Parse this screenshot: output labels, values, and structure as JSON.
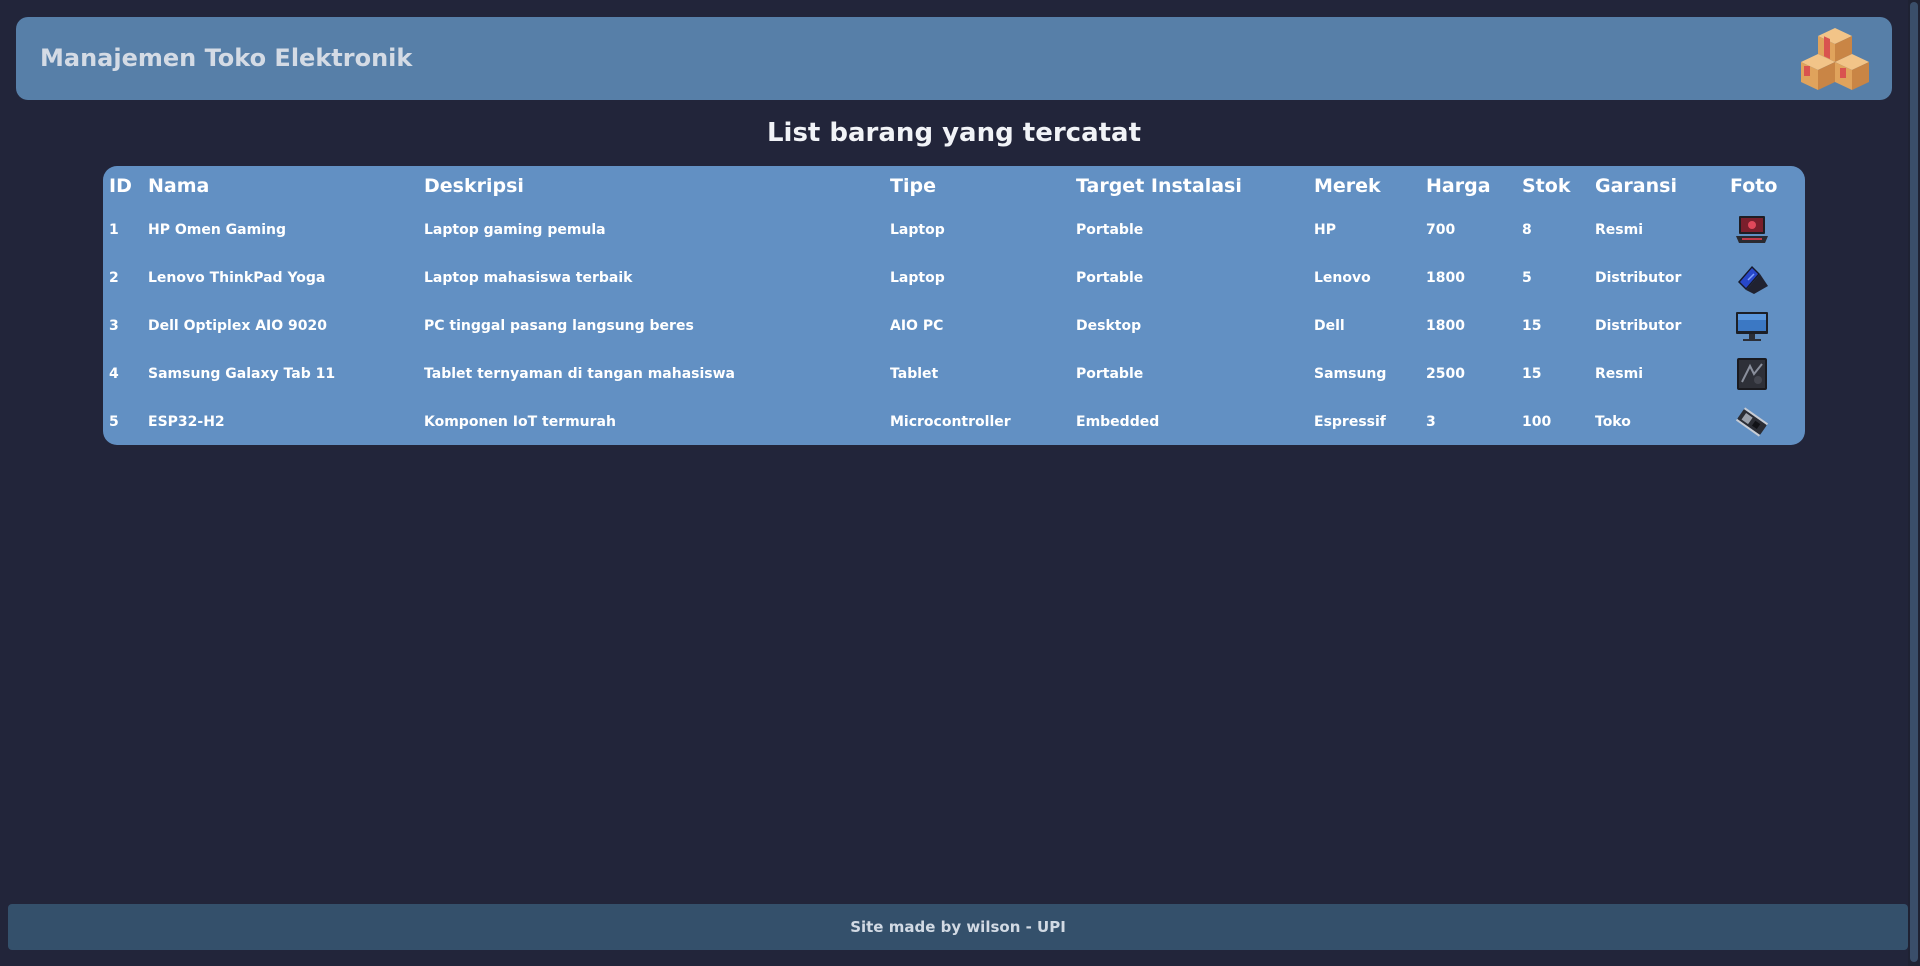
{
  "header": {
    "title": "Manajemen Toko Elektronik",
    "logo_icon": "boxes-icon"
  },
  "main": {
    "title": "List barang yang tercatat"
  },
  "table": {
    "columns": [
      "ID",
      "Nama",
      "Deskripsi",
      "Tipe",
      "Target Instalasi",
      "Merek",
      "Harga",
      "Stok",
      "Garansi",
      "Foto"
    ],
    "rows": [
      {
        "id": "1",
        "nama": "HP Omen Gaming",
        "deskripsi": "Laptop gaming pemula",
        "tipe": "Laptop",
        "target": "Portable",
        "merek": "HP",
        "harga": "700",
        "stok": "8",
        "garansi": "Resmi",
        "foto_icon": "gaming-laptop-icon"
      },
      {
        "id": "2",
        "nama": "Lenovo ThinkPad Yoga",
        "deskripsi": "Laptop mahasiswa terbaik",
        "tipe": "Laptop",
        "target": "Portable",
        "merek": "Lenovo",
        "harga": "1800",
        "stok": "5",
        "garansi": "Distributor",
        "foto_icon": "convertible-laptop-icon"
      },
      {
        "id": "3",
        "nama": "Dell Optiplex AIO 9020",
        "deskripsi": "PC tinggal pasang langsung beres",
        "tipe": "AIO PC",
        "target": "Desktop",
        "merek": "Dell",
        "harga": "1800",
        "stok": "15",
        "garansi": "Distributor",
        "foto_icon": "aio-pc-icon"
      },
      {
        "id": "4",
        "nama": "Samsung Galaxy Tab 11",
        "deskripsi": "Tablet ternyaman di tangan mahasiswa",
        "tipe": "Tablet",
        "target": "Portable",
        "merek": "Samsung",
        "harga": "2500",
        "stok": "15",
        "garansi": "Resmi",
        "foto_icon": "tablet-icon"
      },
      {
        "id": "5",
        "nama": "ESP32-H2",
        "deskripsi": "Komponen IoT termurah",
        "tipe": "Microcontroller",
        "target": "Embedded",
        "merek": "Espressif",
        "harga": "3",
        "stok": "100",
        "garansi": "Toko",
        "foto_icon": "microcontroller-board-icon"
      }
    ]
  },
  "footer": {
    "text": "Site made by wilson - UPI"
  },
  "colors": {
    "background": "#22253a",
    "header": "#577fa8",
    "table": "#6290c3",
    "footer": "#34506b"
  }
}
